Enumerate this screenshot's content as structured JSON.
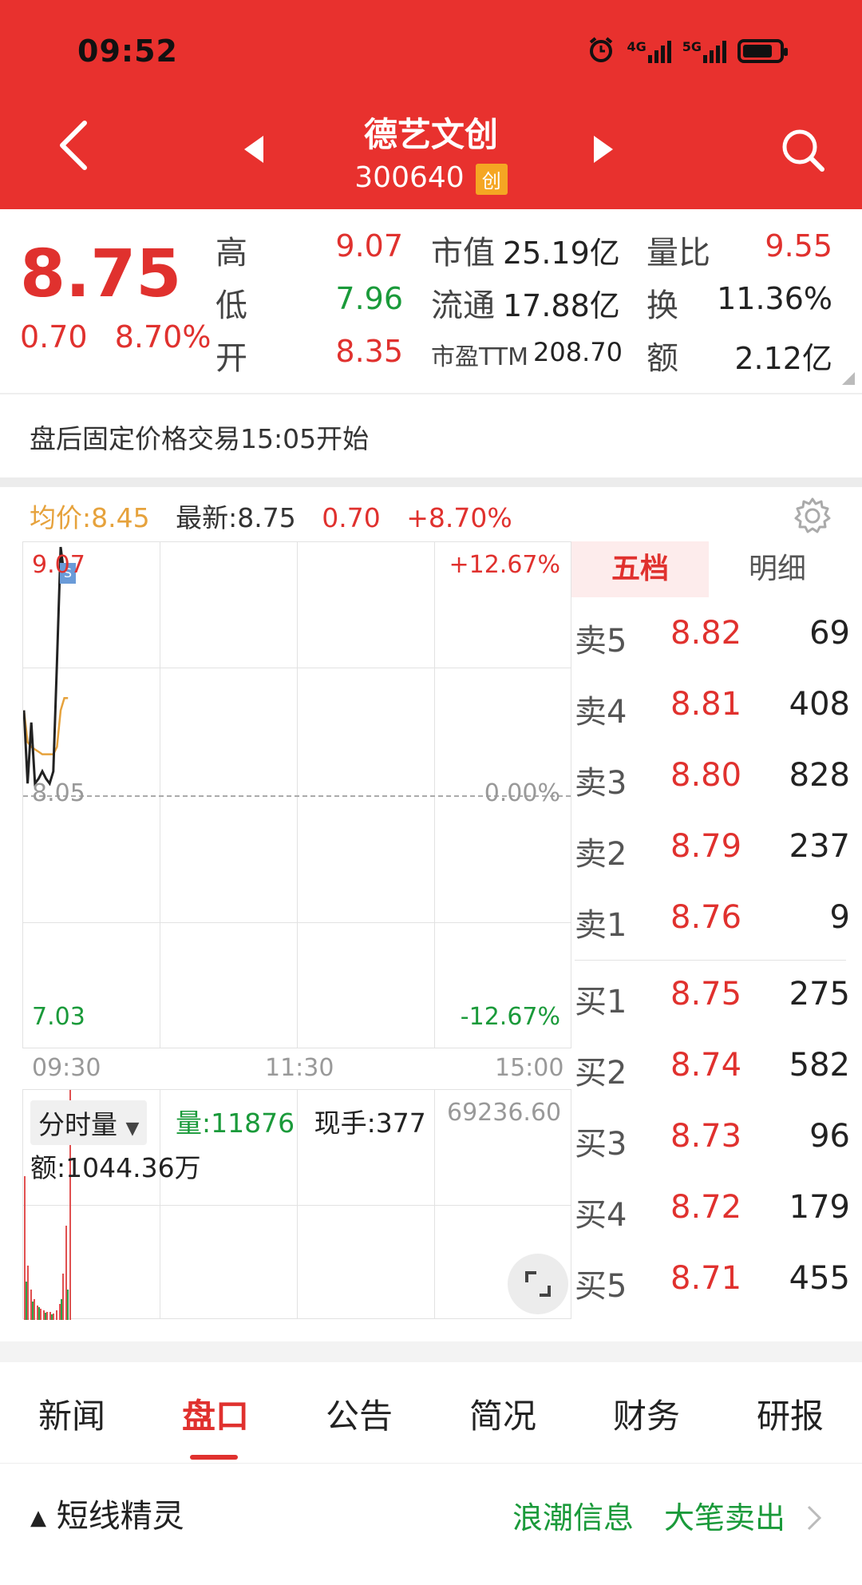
{
  "status_bar": {
    "time": "09:52",
    "net1": "4G",
    "net2": "5G"
  },
  "header": {
    "title": "德艺文创",
    "code": "300640",
    "board_badge": "创"
  },
  "quote": {
    "price": "8.75",
    "change": "0.70",
    "change_pct": "8.70%",
    "high_label": "高",
    "high": "9.07",
    "low_label": "低",
    "low": "7.96",
    "open_label": "开",
    "open": "8.35",
    "mktcap_label": "市值",
    "mktcap": "25.19亿",
    "float_label": "流通",
    "float": "17.88亿",
    "pe_label": "市盈TTM",
    "pe": "208.70",
    "volratio_label": "量比",
    "volratio": "9.55",
    "turnover_label": "换",
    "turnover": "11.36%",
    "amount_label": "额",
    "amount": "2.12亿"
  },
  "notice": "盘后固定价格交易15:05开始",
  "chart_header": {
    "avg_label": "均价:",
    "avg": "8.45",
    "latest_label": "最新:",
    "latest": "8.75",
    "change": "0.70",
    "change_pct": "+8.70%"
  },
  "chart_axes": {
    "y_top": "9.07",
    "y_mid": "8.05",
    "y_bottom": "7.03",
    "pct_top": "+12.67%",
    "pct_mid": "0.00%",
    "pct_bottom": "-12.67%",
    "t_start": "09:30",
    "t_mid": "11:30",
    "t_end": "15:00"
  },
  "volume_panel": {
    "selector": "分时量",
    "vol_label": "量:",
    "vol": "11876",
    "cur_label": "现手:",
    "cur": "377",
    "max": "69236.60",
    "amount_label": "额:",
    "amount": "1044.36万"
  },
  "orderbook": {
    "tab_active": "五档",
    "tab_other": "明细",
    "sells": [
      {
        "label": "卖5",
        "price": "8.82",
        "vol": "69"
      },
      {
        "label": "卖4",
        "price": "8.81",
        "vol": "408"
      },
      {
        "label": "卖3",
        "price": "8.80",
        "vol": "828"
      },
      {
        "label": "卖2",
        "price": "8.79",
        "vol": "237"
      },
      {
        "label": "卖1",
        "price": "8.76",
        "vol": "9"
      }
    ],
    "buys": [
      {
        "label": "买1",
        "price": "8.75",
        "vol": "275"
      },
      {
        "label": "买2",
        "price": "8.74",
        "vol": "582"
      },
      {
        "label": "买3",
        "price": "8.73",
        "vol": "96"
      },
      {
        "label": "买4",
        "price": "8.72",
        "vol": "179"
      },
      {
        "label": "买5",
        "price": "8.71",
        "vol": "455"
      }
    ]
  },
  "tabs": [
    "新闻",
    "盘口",
    "公告",
    "简况",
    "财务",
    "研报"
  ],
  "bottom_bar": {
    "left": "短线精灵",
    "stock": "浪潮信息",
    "action": "大笔卖出"
  },
  "chart_data": {
    "type": "line",
    "x": [
      "09:30",
      "09:31",
      "09:32",
      "09:33",
      "09:34",
      "09:35",
      "09:36",
      "09:37",
      "09:38",
      "09:39",
      "09:40",
      "09:41",
      "09:42"
    ],
    "series": [
      {
        "values": [
          8.4,
          8.1,
          8.35,
          8.1,
          8.12,
          8.15,
          8.12,
          8.1,
          8.15,
          8.6,
          9.07,
          8.95,
          8.93
        ]
      },
      {
        "values": [
          8.4,
          8.27,
          8.25,
          8.24,
          8.23,
          8.22,
          8.22,
          8.22,
          8.22,
          8.25,
          8.4,
          8.45,
          8.45
        ]
      }
    ],
    "ylim": [
      7.03,
      9.07
    ],
    "colors": {
      "price": "#222222",
      "avg": "#e6a23c"
    }
  }
}
